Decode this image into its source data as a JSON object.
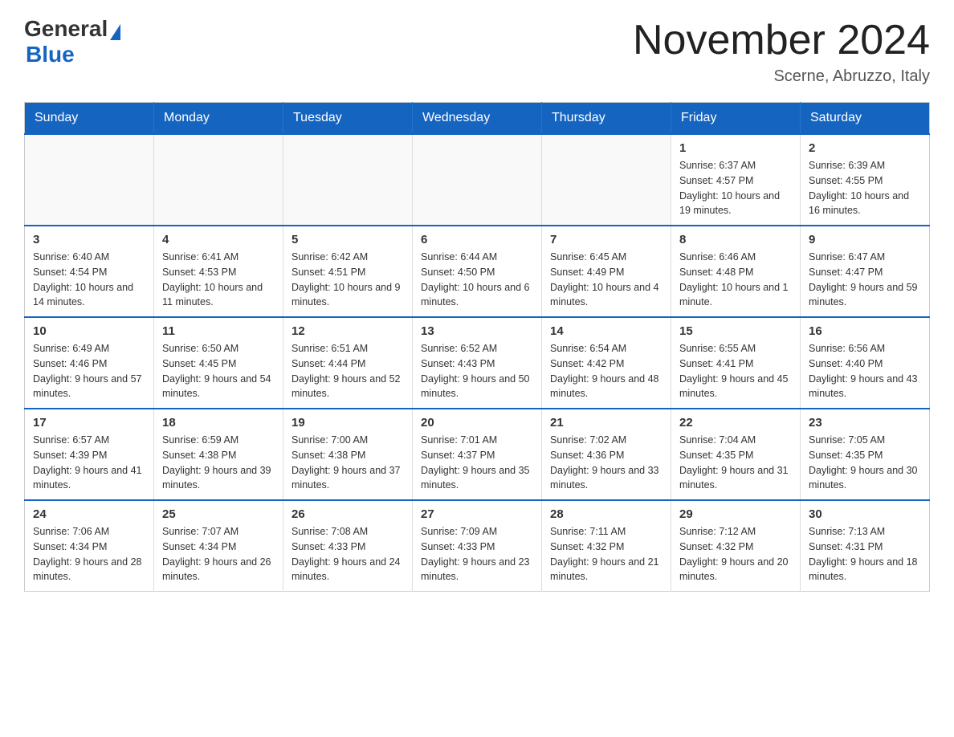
{
  "header": {
    "logo_general": "General",
    "logo_blue": "Blue",
    "month_title": "November 2024",
    "location": "Scerne, Abruzzo, Italy"
  },
  "days_of_week": [
    "Sunday",
    "Monday",
    "Tuesday",
    "Wednesday",
    "Thursday",
    "Friday",
    "Saturday"
  ],
  "weeks": [
    [
      {
        "day": "",
        "info": ""
      },
      {
        "day": "",
        "info": ""
      },
      {
        "day": "",
        "info": ""
      },
      {
        "day": "",
        "info": ""
      },
      {
        "day": "",
        "info": ""
      },
      {
        "day": "1",
        "info": "Sunrise: 6:37 AM\nSunset: 4:57 PM\nDaylight: 10 hours and 19 minutes."
      },
      {
        "day": "2",
        "info": "Sunrise: 6:39 AM\nSunset: 4:55 PM\nDaylight: 10 hours and 16 minutes."
      }
    ],
    [
      {
        "day": "3",
        "info": "Sunrise: 6:40 AM\nSunset: 4:54 PM\nDaylight: 10 hours and 14 minutes."
      },
      {
        "day": "4",
        "info": "Sunrise: 6:41 AM\nSunset: 4:53 PM\nDaylight: 10 hours and 11 minutes."
      },
      {
        "day": "5",
        "info": "Sunrise: 6:42 AM\nSunset: 4:51 PM\nDaylight: 10 hours and 9 minutes."
      },
      {
        "day": "6",
        "info": "Sunrise: 6:44 AM\nSunset: 4:50 PM\nDaylight: 10 hours and 6 minutes."
      },
      {
        "day": "7",
        "info": "Sunrise: 6:45 AM\nSunset: 4:49 PM\nDaylight: 10 hours and 4 minutes."
      },
      {
        "day": "8",
        "info": "Sunrise: 6:46 AM\nSunset: 4:48 PM\nDaylight: 10 hours and 1 minute."
      },
      {
        "day": "9",
        "info": "Sunrise: 6:47 AM\nSunset: 4:47 PM\nDaylight: 9 hours and 59 minutes."
      }
    ],
    [
      {
        "day": "10",
        "info": "Sunrise: 6:49 AM\nSunset: 4:46 PM\nDaylight: 9 hours and 57 minutes."
      },
      {
        "day": "11",
        "info": "Sunrise: 6:50 AM\nSunset: 4:45 PM\nDaylight: 9 hours and 54 minutes."
      },
      {
        "day": "12",
        "info": "Sunrise: 6:51 AM\nSunset: 4:44 PM\nDaylight: 9 hours and 52 minutes."
      },
      {
        "day": "13",
        "info": "Sunrise: 6:52 AM\nSunset: 4:43 PM\nDaylight: 9 hours and 50 minutes."
      },
      {
        "day": "14",
        "info": "Sunrise: 6:54 AM\nSunset: 4:42 PM\nDaylight: 9 hours and 48 minutes."
      },
      {
        "day": "15",
        "info": "Sunrise: 6:55 AM\nSunset: 4:41 PM\nDaylight: 9 hours and 45 minutes."
      },
      {
        "day": "16",
        "info": "Sunrise: 6:56 AM\nSunset: 4:40 PM\nDaylight: 9 hours and 43 minutes."
      }
    ],
    [
      {
        "day": "17",
        "info": "Sunrise: 6:57 AM\nSunset: 4:39 PM\nDaylight: 9 hours and 41 minutes."
      },
      {
        "day": "18",
        "info": "Sunrise: 6:59 AM\nSunset: 4:38 PM\nDaylight: 9 hours and 39 minutes."
      },
      {
        "day": "19",
        "info": "Sunrise: 7:00 AM\nSunset: 4:38 PM\nDaylight: 9 hours and 37 minutes."
      },
      {
        "day": "20",
        "info": "Sunrise: 7:01 AM\nSunset: 4:37 PM\nDaylight: 9 hours and 35 minutes."
      },
      {
        "day": "21",
        "info": "Sunrise: 7:02 AM\nSunset: 4:36 PM\nDaylight: 9 hours and 33 minutes."
      },
      {
        "day": "22",
        "info": "Sunrise: 7:04 AM\nSunset: 4:35 PM\nDaylight: 9 hours and 31 minutes."
      },
      {
        "day": "23",
        "info": "Sunrise: 7:05 AM\nSunset: 4:35 PM\nDaylight: 9 hours and 30 minutes."
      }
    ],
    [
      {
        "day": "24",
        "info": "Sunrise: 7:06 AM\nSunset: 4:34 PM\nDaylight: 9 hours and 28 minutes."
      },
      {
        "day": "25",
        "info": "Sunrise: 7:07 AM\nSunset: 4:34 PM\nDaylight: 9 hours and 26 minutes."
      },
      {
        "day": "26",
        "info": "Sunrise: 7:08 AM\nSunset: 4:33 PM\nDaylight: 9 hours and 24 minutes."
      },
      {
        "day": "27",
        "info": "Sunrise: 7:09 AM\nSunset: 4:33 PM\nDaylight: 9 hours and 23 minutes."
      },
      {
        "day": "28",
        "info": "Sunrise: 7:11 AM\nSunset: 4:32 PM\nDaylight: 9 hours and 21 minutes."
      },
      {
        "day": "29",
        "info": "Sunrise: 7:12 AM\nSunset: 4:32 PM\nDaylight: 9 hours and 20 minutes."
      },
      {
        "day": "30",
        "info": "Sunrise: 7:13 AM\nSunset: 4:31 PM\nDaylight: 9 hours and 18 minutes."
      }
    ]
  ]
}
